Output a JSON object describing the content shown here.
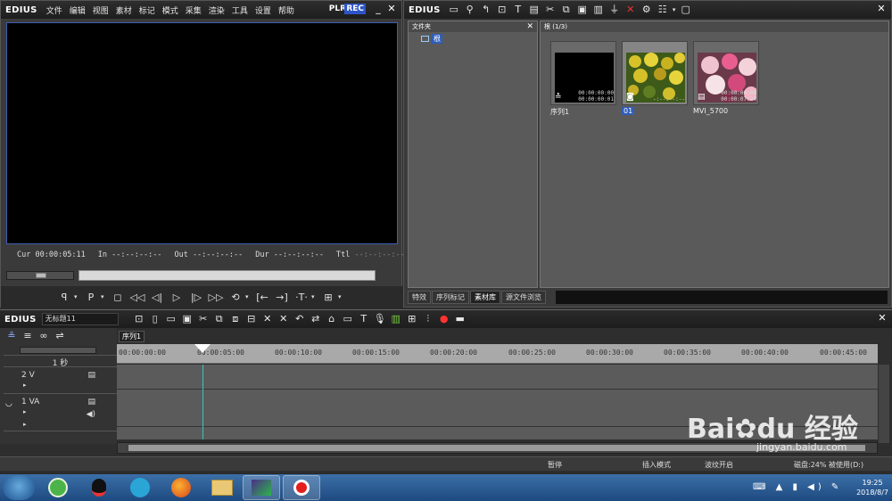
{
  "app_name": "EDIUS",
  "menu": [
    "文件",
    "编辑",
    "视图",
    "素材",
    "标记",
    "模式",
    "采集",
    "渲染",
    "工具",
    "设置",
    "帮助"
  ],
  "player": {
    "plr_label": "PLR",
    "rec_label": "REC",
    "cur_label": "Cur",
    "cur_value": "00:00:05:11",
    "in_label": "In",
    "in_value": "--:--:--:--",
    "out_label": "Out",
    "out_value": "--:--:--:--",
    "dur_label": "Dur",
    "dur_value": "--:--:--:--",
    "ttl_label": "Ttl",
    "ttl_value": "--:--:--:--"
  },
  "bin": {
    "app_name": "EDIUS",
    "folder_pane_title": "文件夹",
    "root_label": "根",
    "clips_header": "根 (1/3)",
    "clips": [
      {
        "name": "序列1",
        "tc_in": "00:00:00:00",
        "tc_out": "00:00:00:01",
        "type_icon": "sequence-icon",
        "selected": false
      },
      {
        "name": "01",
        "tc_in": "",
        "tc_out": "-:--:--:--",
        "type_icon": "still-image-icon",
        "selected": true
      },
      {
        "name": "MVI_5700",
        "tc_in": "00:00:00:00",
        "tc_out": "00:00:07:24",
        "type_icon": "video-clip-icon",
        "selected": false
      }
    ],
    "tabs": [
      "特效",
      "序列标记",
      "素材库",
      "源文件浏览"
    ],
    "active_tab": "素材库"
  },
  "timeline": {
    "app_name": "EDIUS",
    "project_name": "无标题11",
    "sequence_tab": "序列1",
    "scale_label": "1 秒",
    "tracks": [
      {
        "name": "2 V"
      },
      {
        "name": "1 VA"
      }
    ],
    "ruler_ticks": [
      "00:00:00:00",
      "00:00:05:00",
      "00:00:10:00",
      "00:00:15:00",
      "00:00:20:00",
      "00:00:25:00",
      "00:00:30:00",
      "00:00:35:00",
      "00:00:40:00",
      "00:00:45:00"
    ],
    "status": {
      "state": "暂停",
      "mode": "插入模式",
      "ripple": "波纹开启",
      "disk": "磁盘:24% 被使用(D:)"
    }
  },
  "taskbar": {
    "time": "19:25",
    "date": "2018/8/7"
  },
  "watermark": {
    "brand": "Bai",
    "brand2": "du",
    "suffix": "经验",
    "url": "jingyan.baidu.com"
  }
}
